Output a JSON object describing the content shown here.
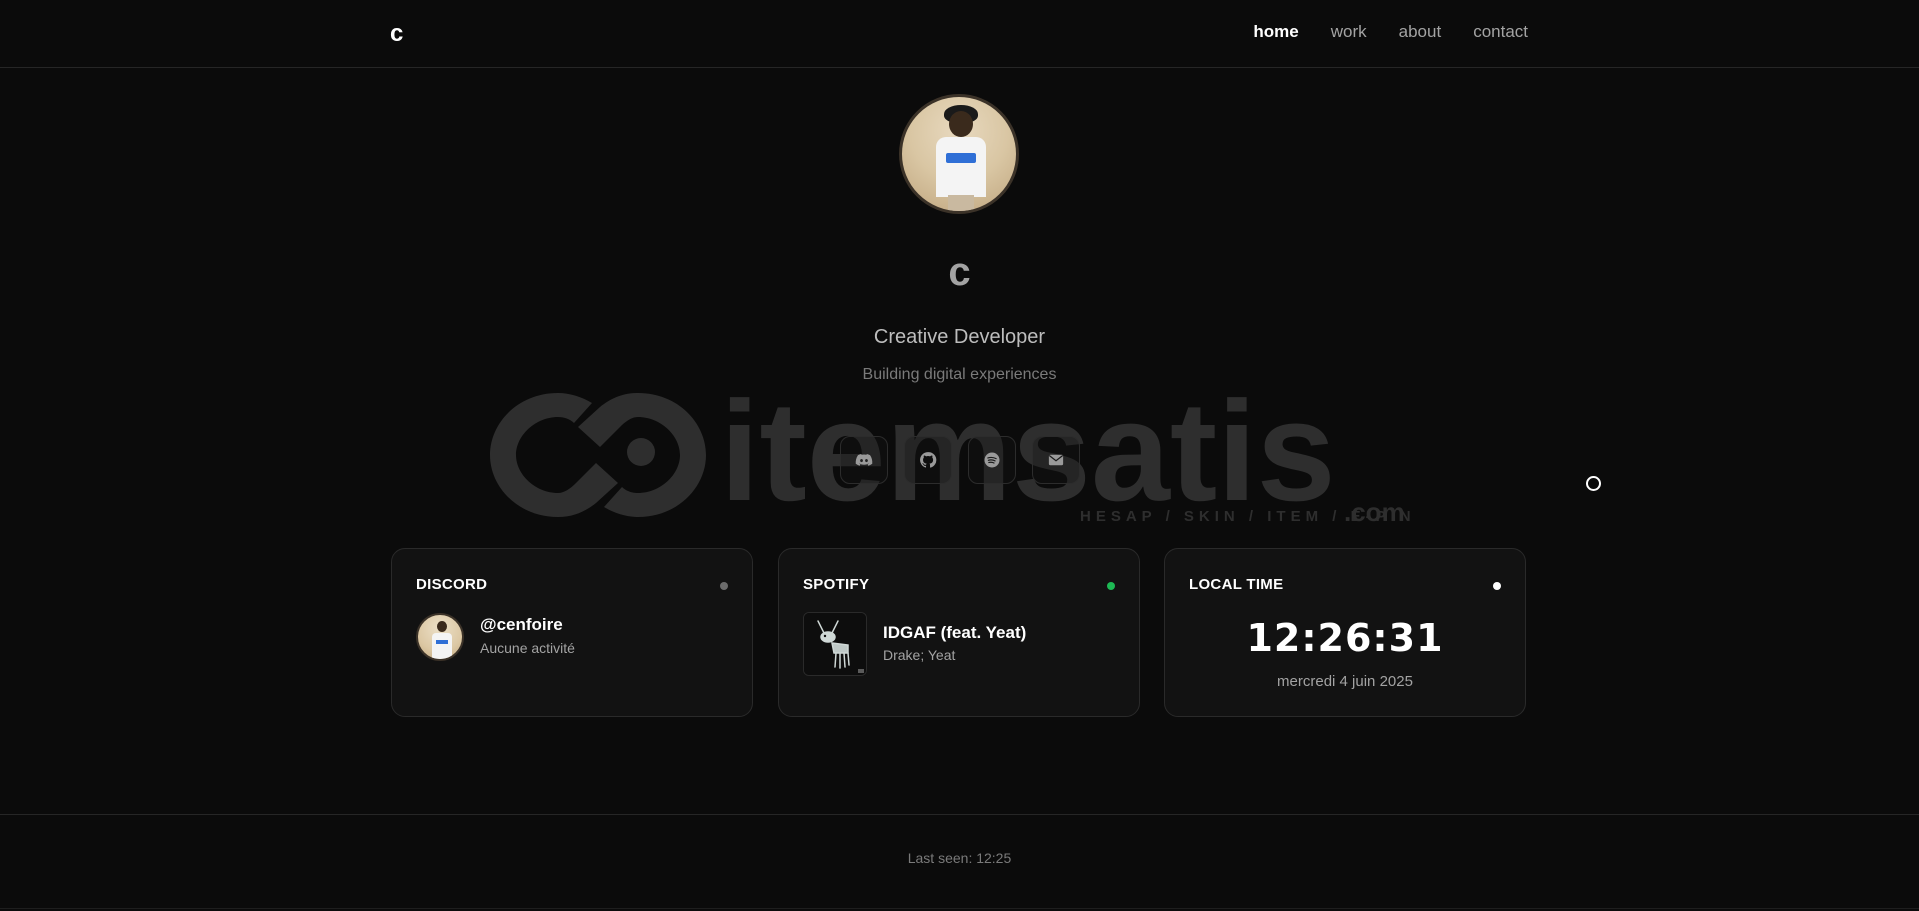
{
  "header": {
    "logo": "c",
    "nav": [
      "home",
      "work",
      "about",
      "contact"
    ],
    "active": "home"
  },
  "hero": {
    "name": "c",
    "role": "Creative Developer",
    "tagline": "Building digital experiences"
  },
  "socials": [
    {
      "name": "discord",
      "icon": "discord-icon"
    },
    {
      "name": "github",
      "icon": "github-icon"
    },
    {
      "name": "spotify",
      "icon": "spotify-icon"
    },
    {
      "name": "email",
      "icon": "mail-icon"
    }
  ],
  "watermark": {
    "brand": "itemsatis",
    "sub": "HESAP / SKIN / ITEM / E-PIN",
    "com": ".com"
  },
  "discord_card": {
    "title": "DISCORD",
    "status_color": "#6b6b6b",
    "username": "@cenfoire",
    "activity": "Aucune activité"
  },
  "spotify_card": {
    "title": "SPOTIFY",
    "status_color": "#1db954",
    "track": "IDGAF (feat. Yeat)",
    "artist": "Drake; Yeat"
  },
  "time_card": {
    "title": "LOCAL TIME",
    "status_color": "#ffffff",
    "time": "12:26:31",
    "date": "mercredi 4 juin 2025"
  },
  "footer": {
    "last_seen": "Last seen: 12:25"
  },
  "colors": {
    "background": "#0b0b0b",
    "card": "#121212",
    "border": "#2a2a2a"
  }
}
